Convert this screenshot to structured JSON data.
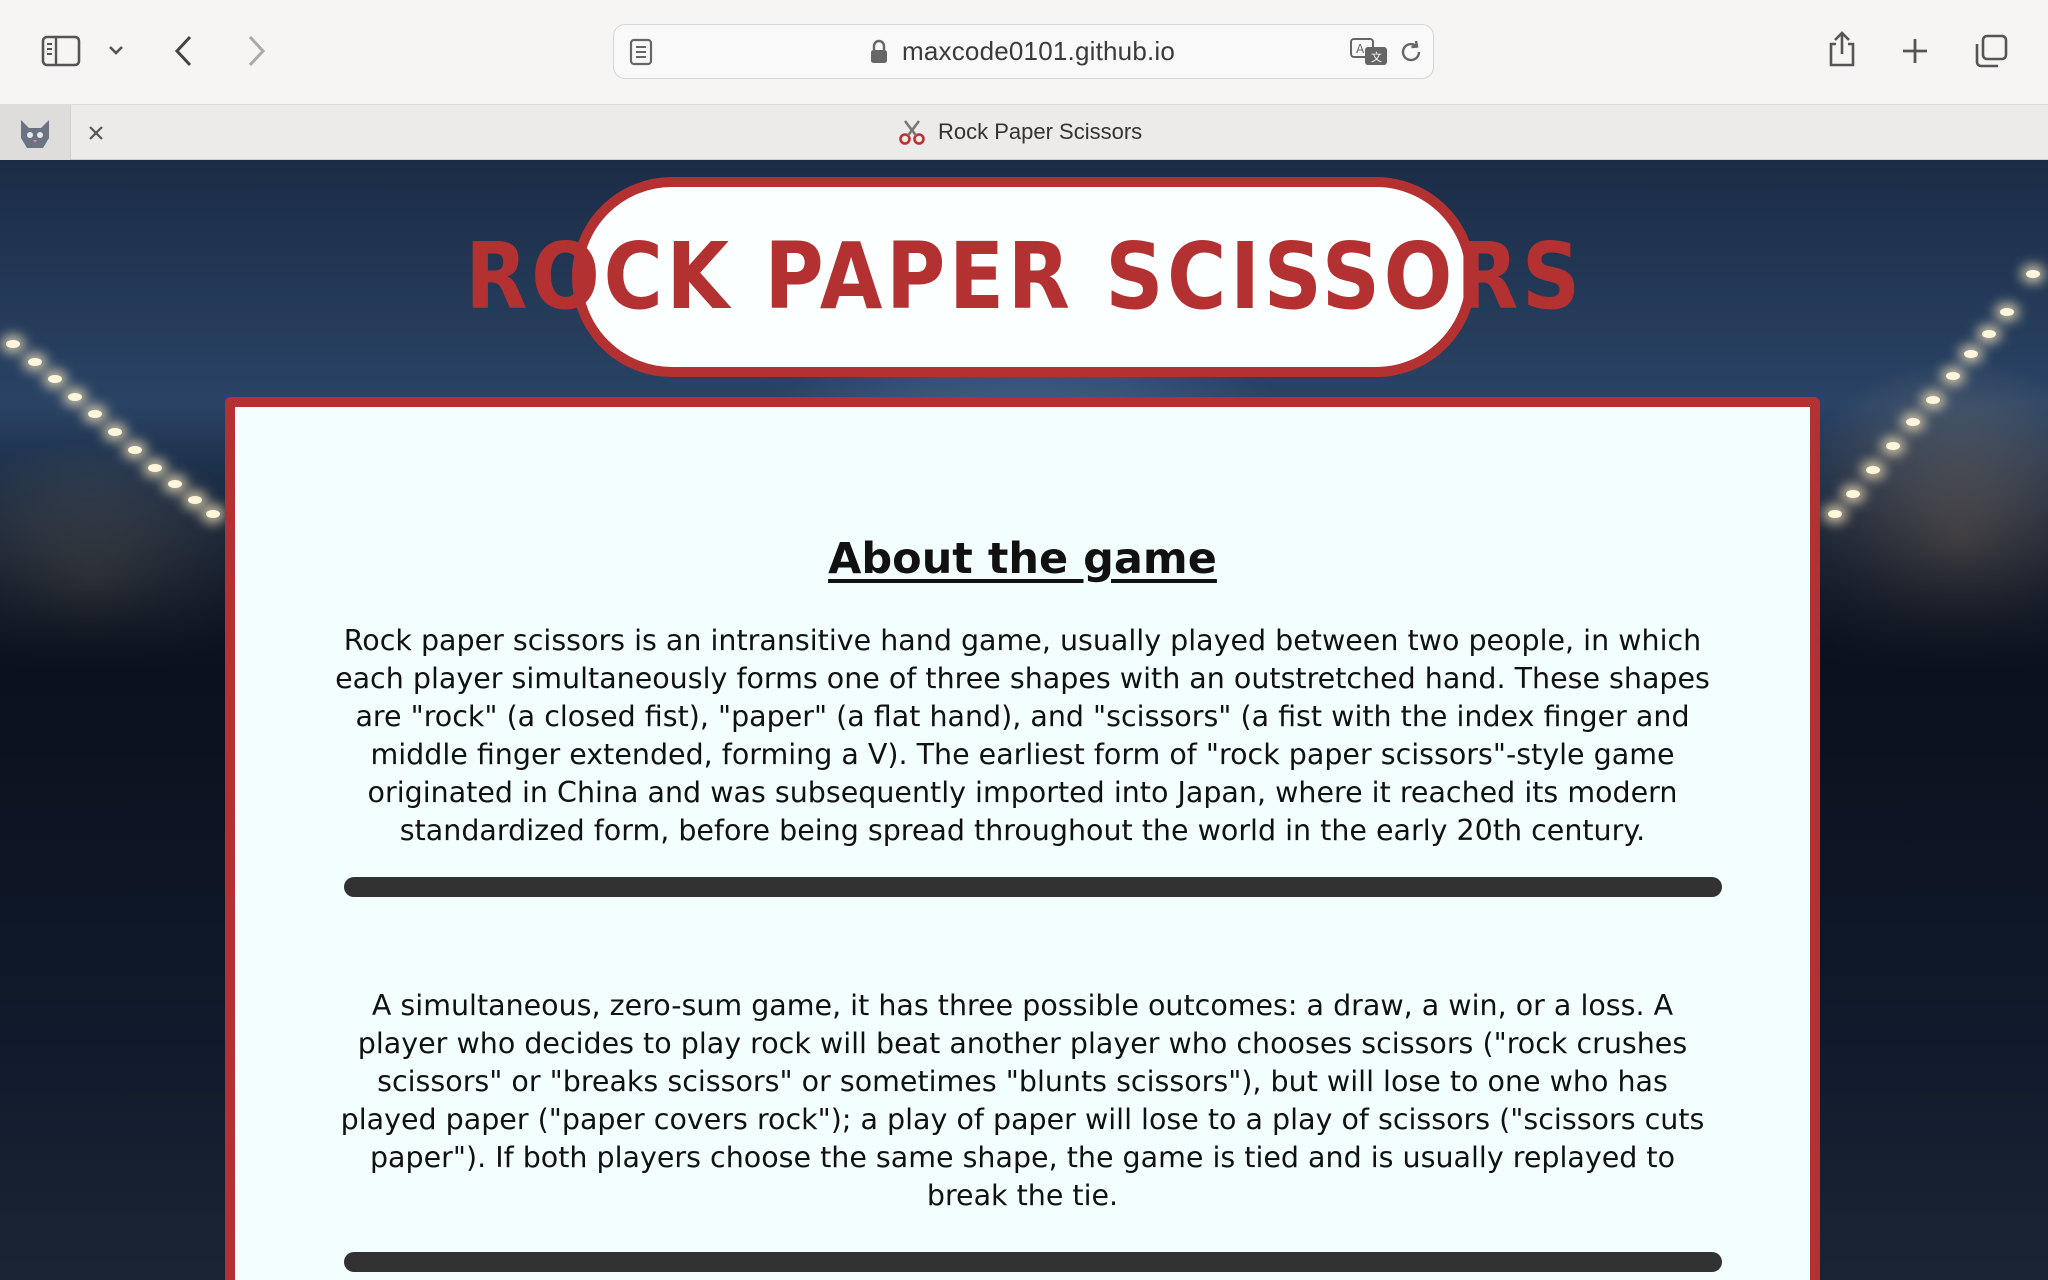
{
  "browser": {
    "url": "maxcode0101.github.io",
    "tab": {
      "icon": "scissors-icon",
      "title": "Rock Paper Scissors"
    }
  },
  "page": {
    "title": "ROCK PAPER SCISSORS",
    "heading": "About the game",
    "paragraphs": [
      "Rock paper scissors is an intransitive hand game, usually played between two people, in which each player simultaneously forms one of three shapes with an outstretched hand. These shapes are \"rock\" (a closed fist), \"paper\" (a flat hand), and \"scissors\" (a fist with the index finger and middle finger extended, forming a V). The earliest form of \"rock paper scissors\"-style game originated in China and was subsequently imported into Japan, where it reached its modern standardized form, before being spread throughout the world in the early 20th century.",
      "A simultaneous, zero-sum game, it has three possible outcomes: a draw, a win, or a loss. A player who decides to play rock will beat another player who chooses scissors (\"rock crushes scissors\" or \"breaks scissors\" or sometimes \"blunts scissors\"), but will lose to one who has played paper (\"paper covers rock\"); a play of paper will lose to a play of scissors (\"scissors cuts paper\"). If both players choose the same shape, the game is tied and is usually replayed to break the tie."
    ]
  },
  "colors": {
    "accent": "#b43131",
    "card_background": "#f3ffff",
    "divider": "#323232"
  }
}
